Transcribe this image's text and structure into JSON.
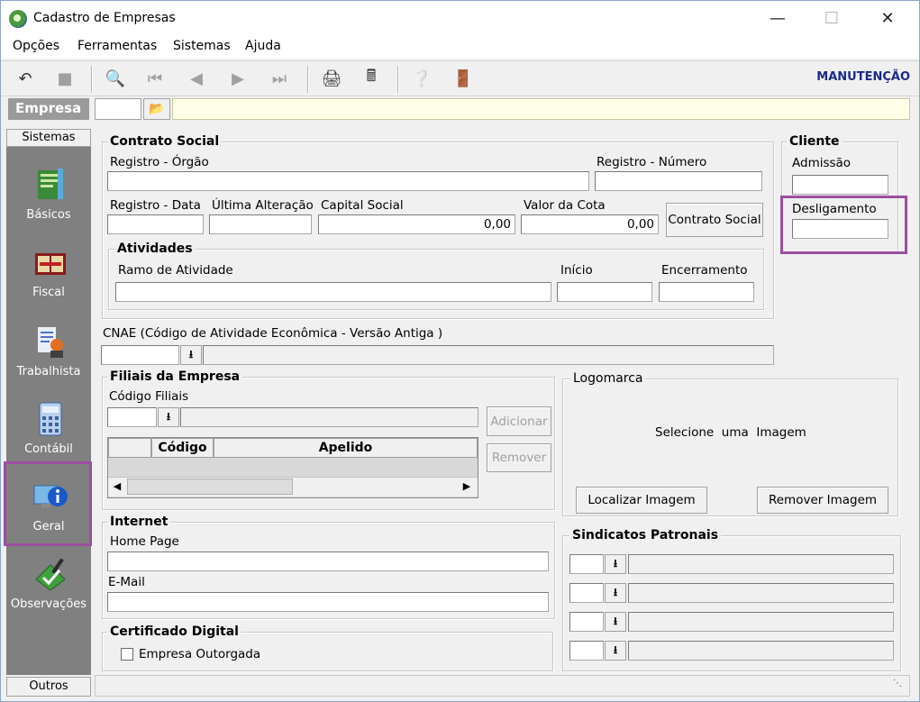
{
  "window": {
    "title": "Cadastro de Empresas"
  },
  "menu": [
    "Opções",
    "Ferramentas",
    "Sistemas",
    "Ajuda"
  ],
  "toolbar": {
    "mode": "MANUTENÇÃO"
  },
  "empresa": {
    "label": "Empresa"
  },
  "sidebar": {
    "header": "Sistemas",
    "footer": "Outros",
    "items": [
      {
        "label": "Básicos"
      },
      {
        "label": "Fiscal"
      },
      {
        "label": "Trabalhista"
      },
      {
        "label": "Contábil"
      },
      {
        "label": "Geral"
      },
      {
        "label": "Observações"
      }
    ]
  },
  "contrato": {
    "title": "Contrato Social",
    "registro_orgao": "Registro - Órgão",
    "registro_numero": "Registro - Número",
    "registro_data": "Registro - Data",
    "ultima_alteracao": "Última Alteração",
    "capital_social": "Capital Social",
    "capital_social_value": "0,00",
    "valor_cota": "Valor da Cota",
    "valor_cota_value": "0,00",
    "button": "Contrato Social"
  },
  "atividades": {
    "title": "Atividades",
    "ramo": "Ramo de Atividade",
    "inicio": "Início",
    "encerramento": "Encerramento"
  },
  "cliente": {
    "title": "Cliente",
    "admissao": "Admissão",
    "desligamento": "Desligamento"
  },
  "cnae": {
    "label": "CNAE (Código de Atividade Econômica - Versão Antiga )"
  },
  "filiais": {
    "title": "Filiais da Empresa",
    "codigo": "Código Filiais",
    "adicionar": "Adicionar",
    "remover": "Remover",
    "columns": [
      "Código",
      "Apelido"
    ]
  },
  "logomarca": {
    "title": "Logomarca",
    "placeholder": "Selecione  uma  Imagem",
    "localizar": "Localizar Imagem",
    "remover": "Remover Imagem"
  },
  "internet": {
    "title": "Internet",
    "home_page": "Home Page",
    "email": "E-Mail"
  },
  "sindicatos": {
    "title": "Sindicatos Patronais"
  },
  "certificado": {
    "title": "Certificado Digital",
    "outorgada": "Empresa Outorgada"
  }
}
